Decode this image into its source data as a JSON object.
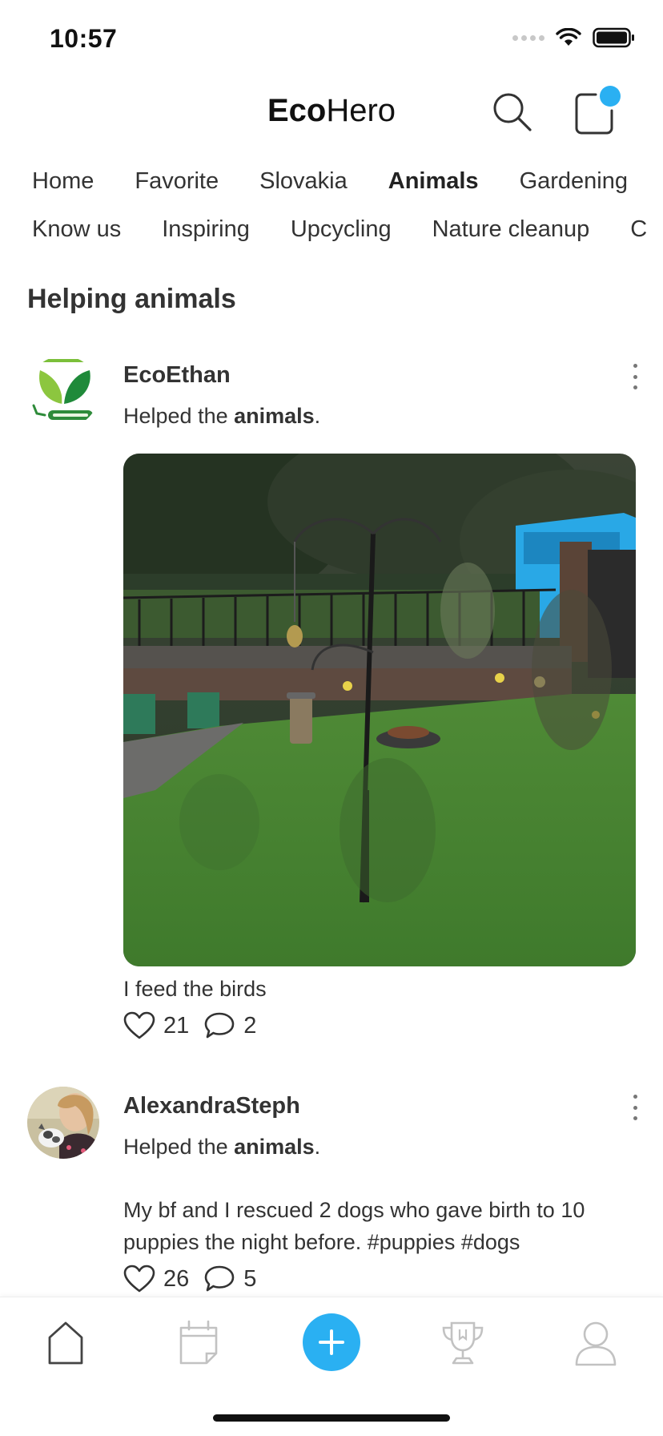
{
  "status": {
    "time": "10:57"
  },
  "header": {
    "title_bold": "Eco",
    "title_regular": "Hero",
    "search_icon": "search-icon",
    "notification_icon": "notification-icon",
    "accent_color": "#2ab0f2"
  },
  "nav": {
    "row1": [
      "Home",
      "Favorite",
      "Slovakia",
      "Animals",
      "Gardening"
    ],
    "row2": [
      "Know us",
      "Inspiring",
      "Upcycling",
      "Nature cleanup",
      "C"
    ],
    "active": "Animals"
  },
  "section": {
    "title": "Helping animals"
  },
  "posts": [
    {
      "username": "EcoEthan",
      "action_prefix": "Helped the ",
      "action_bold": "animals",
      "action_suffix": ".",
      "caption": "I feed the birds",
      "likes": "21",
      "comments": "2",
      "avatar_icon": "eco-friendly-leaf-logo-icon"
    },
    {
      "username": "AlexandraSteph",
      "action_prefix": "Helped the ",
      "action_bold": "animals",
      "action_suffix": ".",
      "caption": "My bf and I rescued 2 dogs who gave birth to 10 puppies the night before. #puppies #dogs",
      "likes": "26",
      "comments": "5"
    }
  ],
  "tabbar": {
    "items": [
      "home-icon",
      "calendar-icon",
      "add-icon",
      "trophy-icon",
      "profile-icon"
    ]
  }
}
